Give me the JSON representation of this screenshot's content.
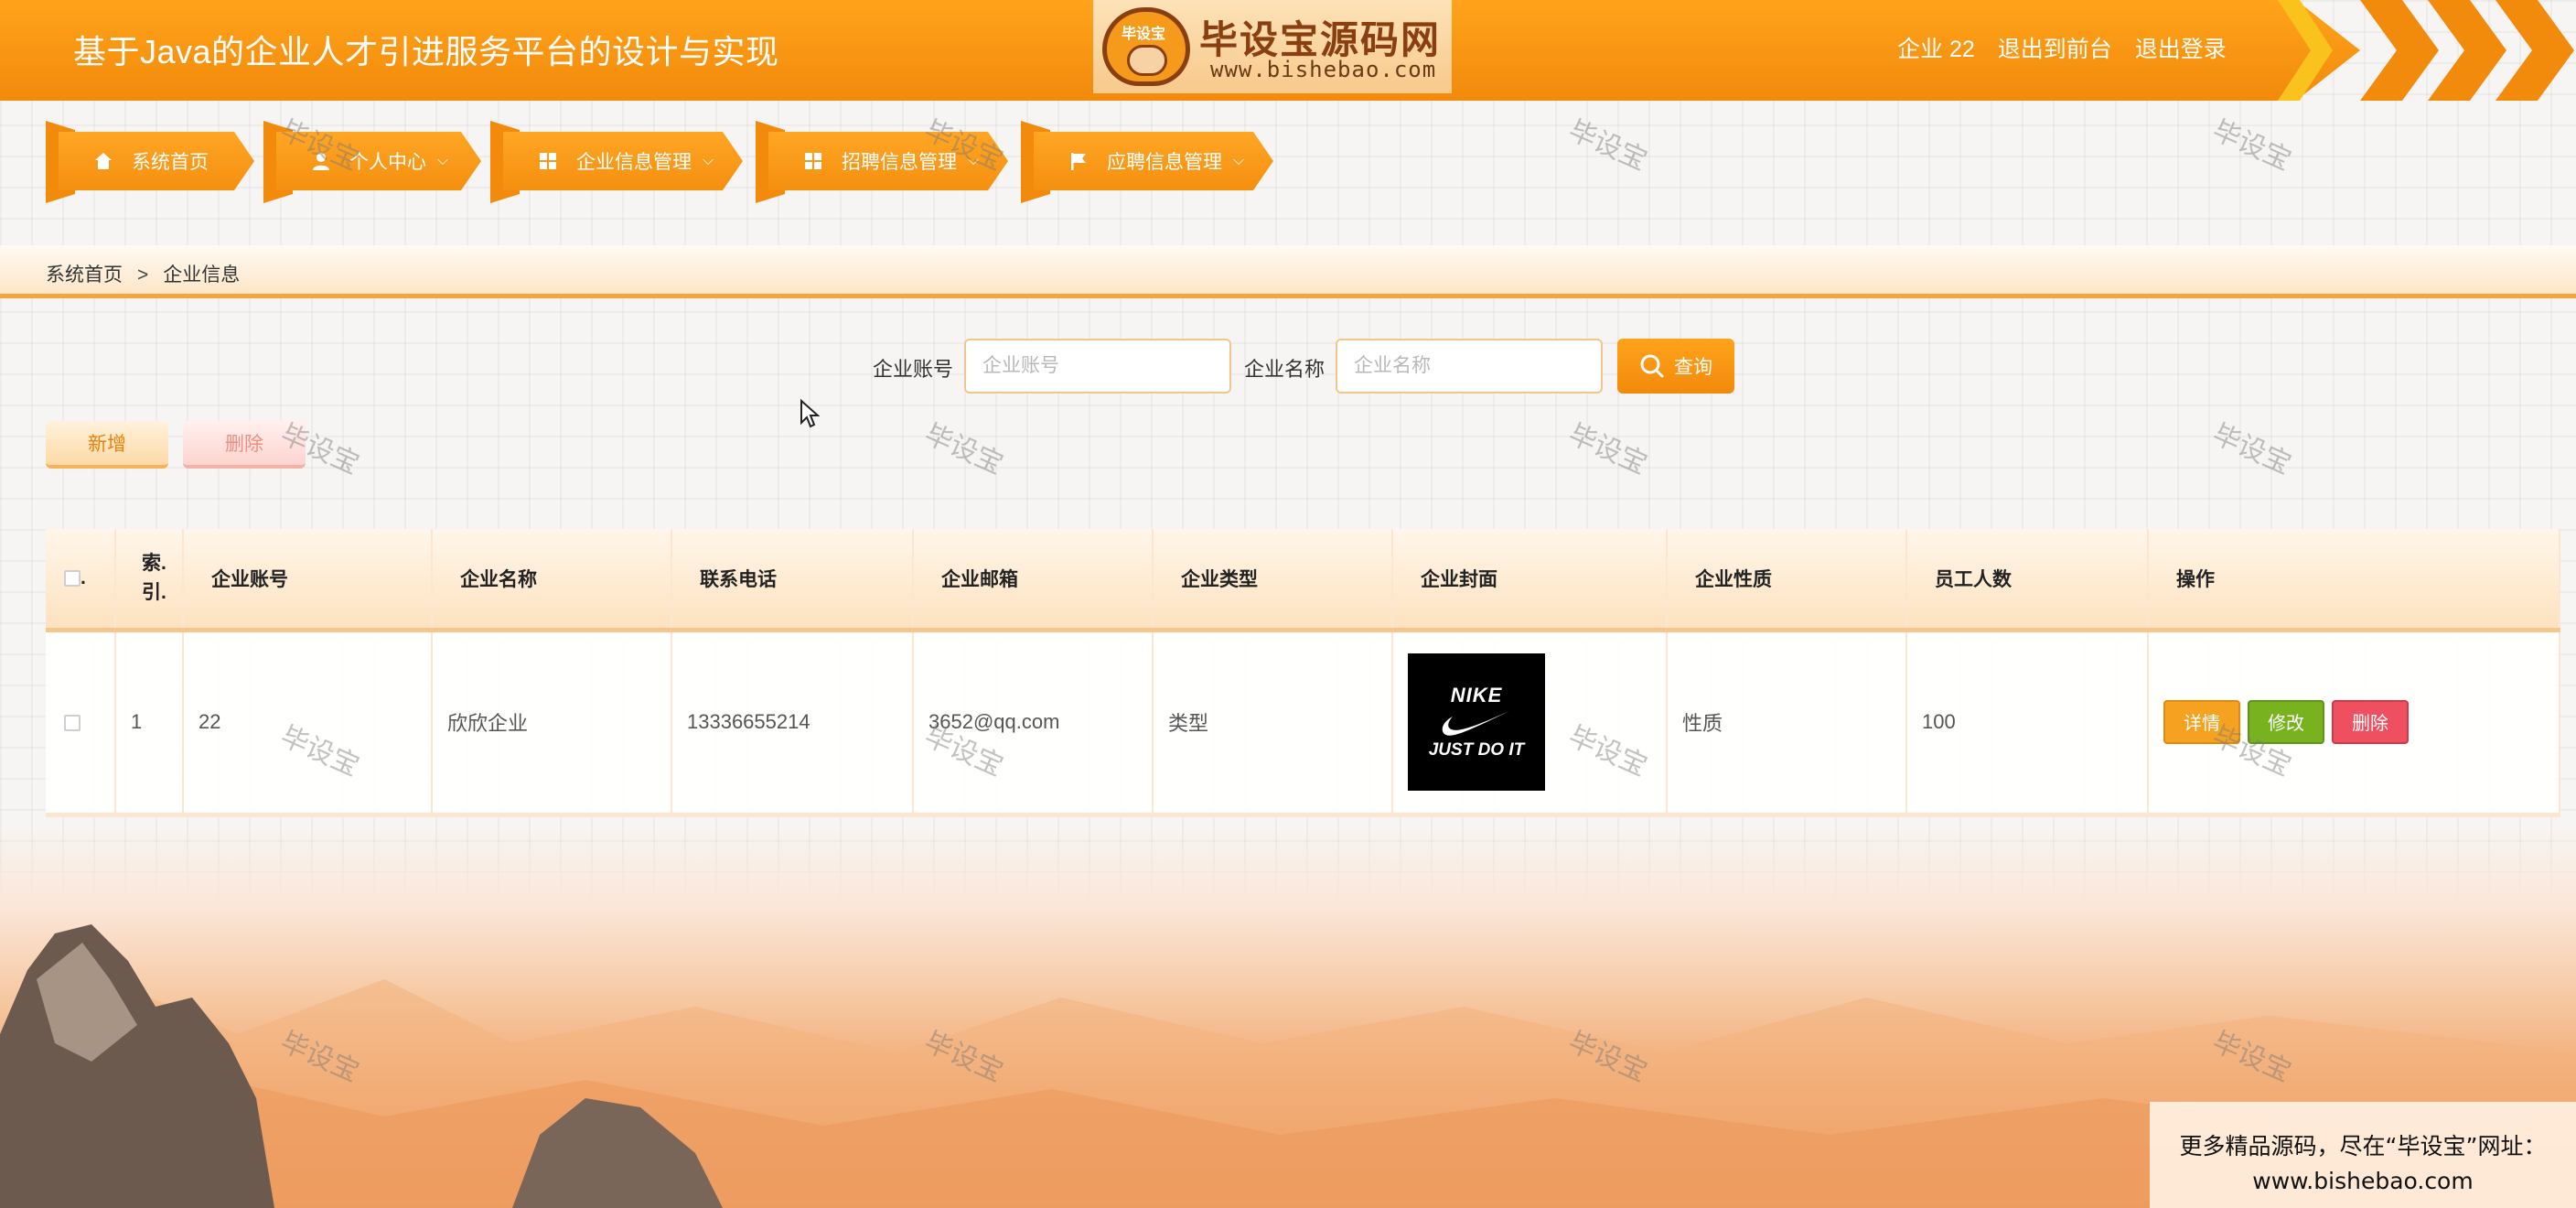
{
  "header": {
    "title": "基于Java的企业人才引进服务平台的设计与实现",
    "user_label": "企业 22",
    "link_front": "退出到前台",
    "link_logout": "退出登录"
  },
  "logo": {
    "badge": "毕设宝",
    "name": "毕设宝源码网",
    "url": "www.bishebao.com"
  },
  "nav": {
    "items": [
      {
        "label": "系统首页",
        "icon": "home-icon"
      },
      {
        "label": "个人中心",
        "icon": "user-icon"
      },
      {
        "label": "企业信息管理",
        "icon": "grid-icon"
      },
      {
        "label": "招聘信息管理",
        "icon": "grid-icon"
      },
      {
        "label": "应聘信息管理",
        "icon": "flag-icon"
      }
    ]
  },
  "breadcrumb": {
    "home": "系统首页",
    "separator": ">",
    "current": "企业信息"
  },
  "search": {
    "account_label": "企业账号",
    "account_placeholder": "企业账号",
    "name_label": "企业名称",
    "name_placeholder": "企业名称",
    "button": "查询"
  },
  "actions": {
    "add": "新增",
    "delete": "删除"
  },
  "table": {
    "headers": [
      "",
      "索.\n引.",
      "企业账号",
      "企业名称",
      "联系电话",
      "企业邮箱",
      "企业类型",
      "企业封面",
      "企业性质",
      "员工人数",
      "操作"
    ],
    "header_check": ".",
    "rows": [
      {
        "index": "1",
        "account": "22",
        "name": "欣欣企业",
        "phone": "13336655214",
        "email": "3652@qq.com",
        "type": "类型",
        "cover_line1": "NIKE",
        "cover_line2": "JUST DO IT",
        "nature": "性质",
        "employees": "100",
        "op_detail": "详情",
        "op_edit": "修改",
        "op_delete": "删除"
      }
    ]
  },
  "watermark": "毕设宝",
  "ad": {
    "line1": "更多精品源码，尽在“毕设宝”网址：",
    "line2": "www.bishebao.com"
  },
  "colors": {
    "brand_orange": "#f28a0c",
    "detail": "#f5a220",
    "edit": "#78b31f",
    "delete": "#ee5060"
  }
}
